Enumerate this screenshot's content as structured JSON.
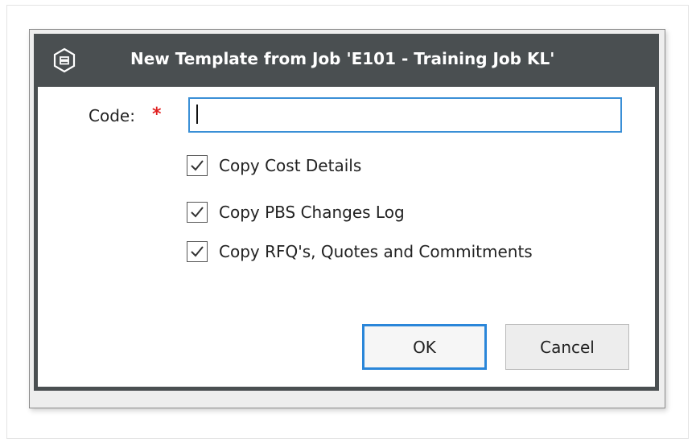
{
  "dialog": {
    "title": "New Template from Job 'E101 - Training Job KL'",
    "app_icon": "app-logo-icon"
  },
  "form": {
    "code_label": "Code:",
    "required_marker": "*",
    "code_value": "",
    "code_placeholder": ""
  },
  "options": [
    {
      "label": "Copy Cost Details",
      "checked": true
    },
    {
      "label": "Copy PBS Changes Log",
      "checked": true
    },
    {
      "label": "Copy RFQ's, Quotes and Commitments",
      "checked": true
    }
  ],
  "buttons": {
    "ok_label": "OK",
    "cancel_label": "Cancel"
  },
  "colors": {
    "titlebar": "#4a4f51",
    "focus_border": "#2a86d9",
    "required": "#e02020"
  }
}
